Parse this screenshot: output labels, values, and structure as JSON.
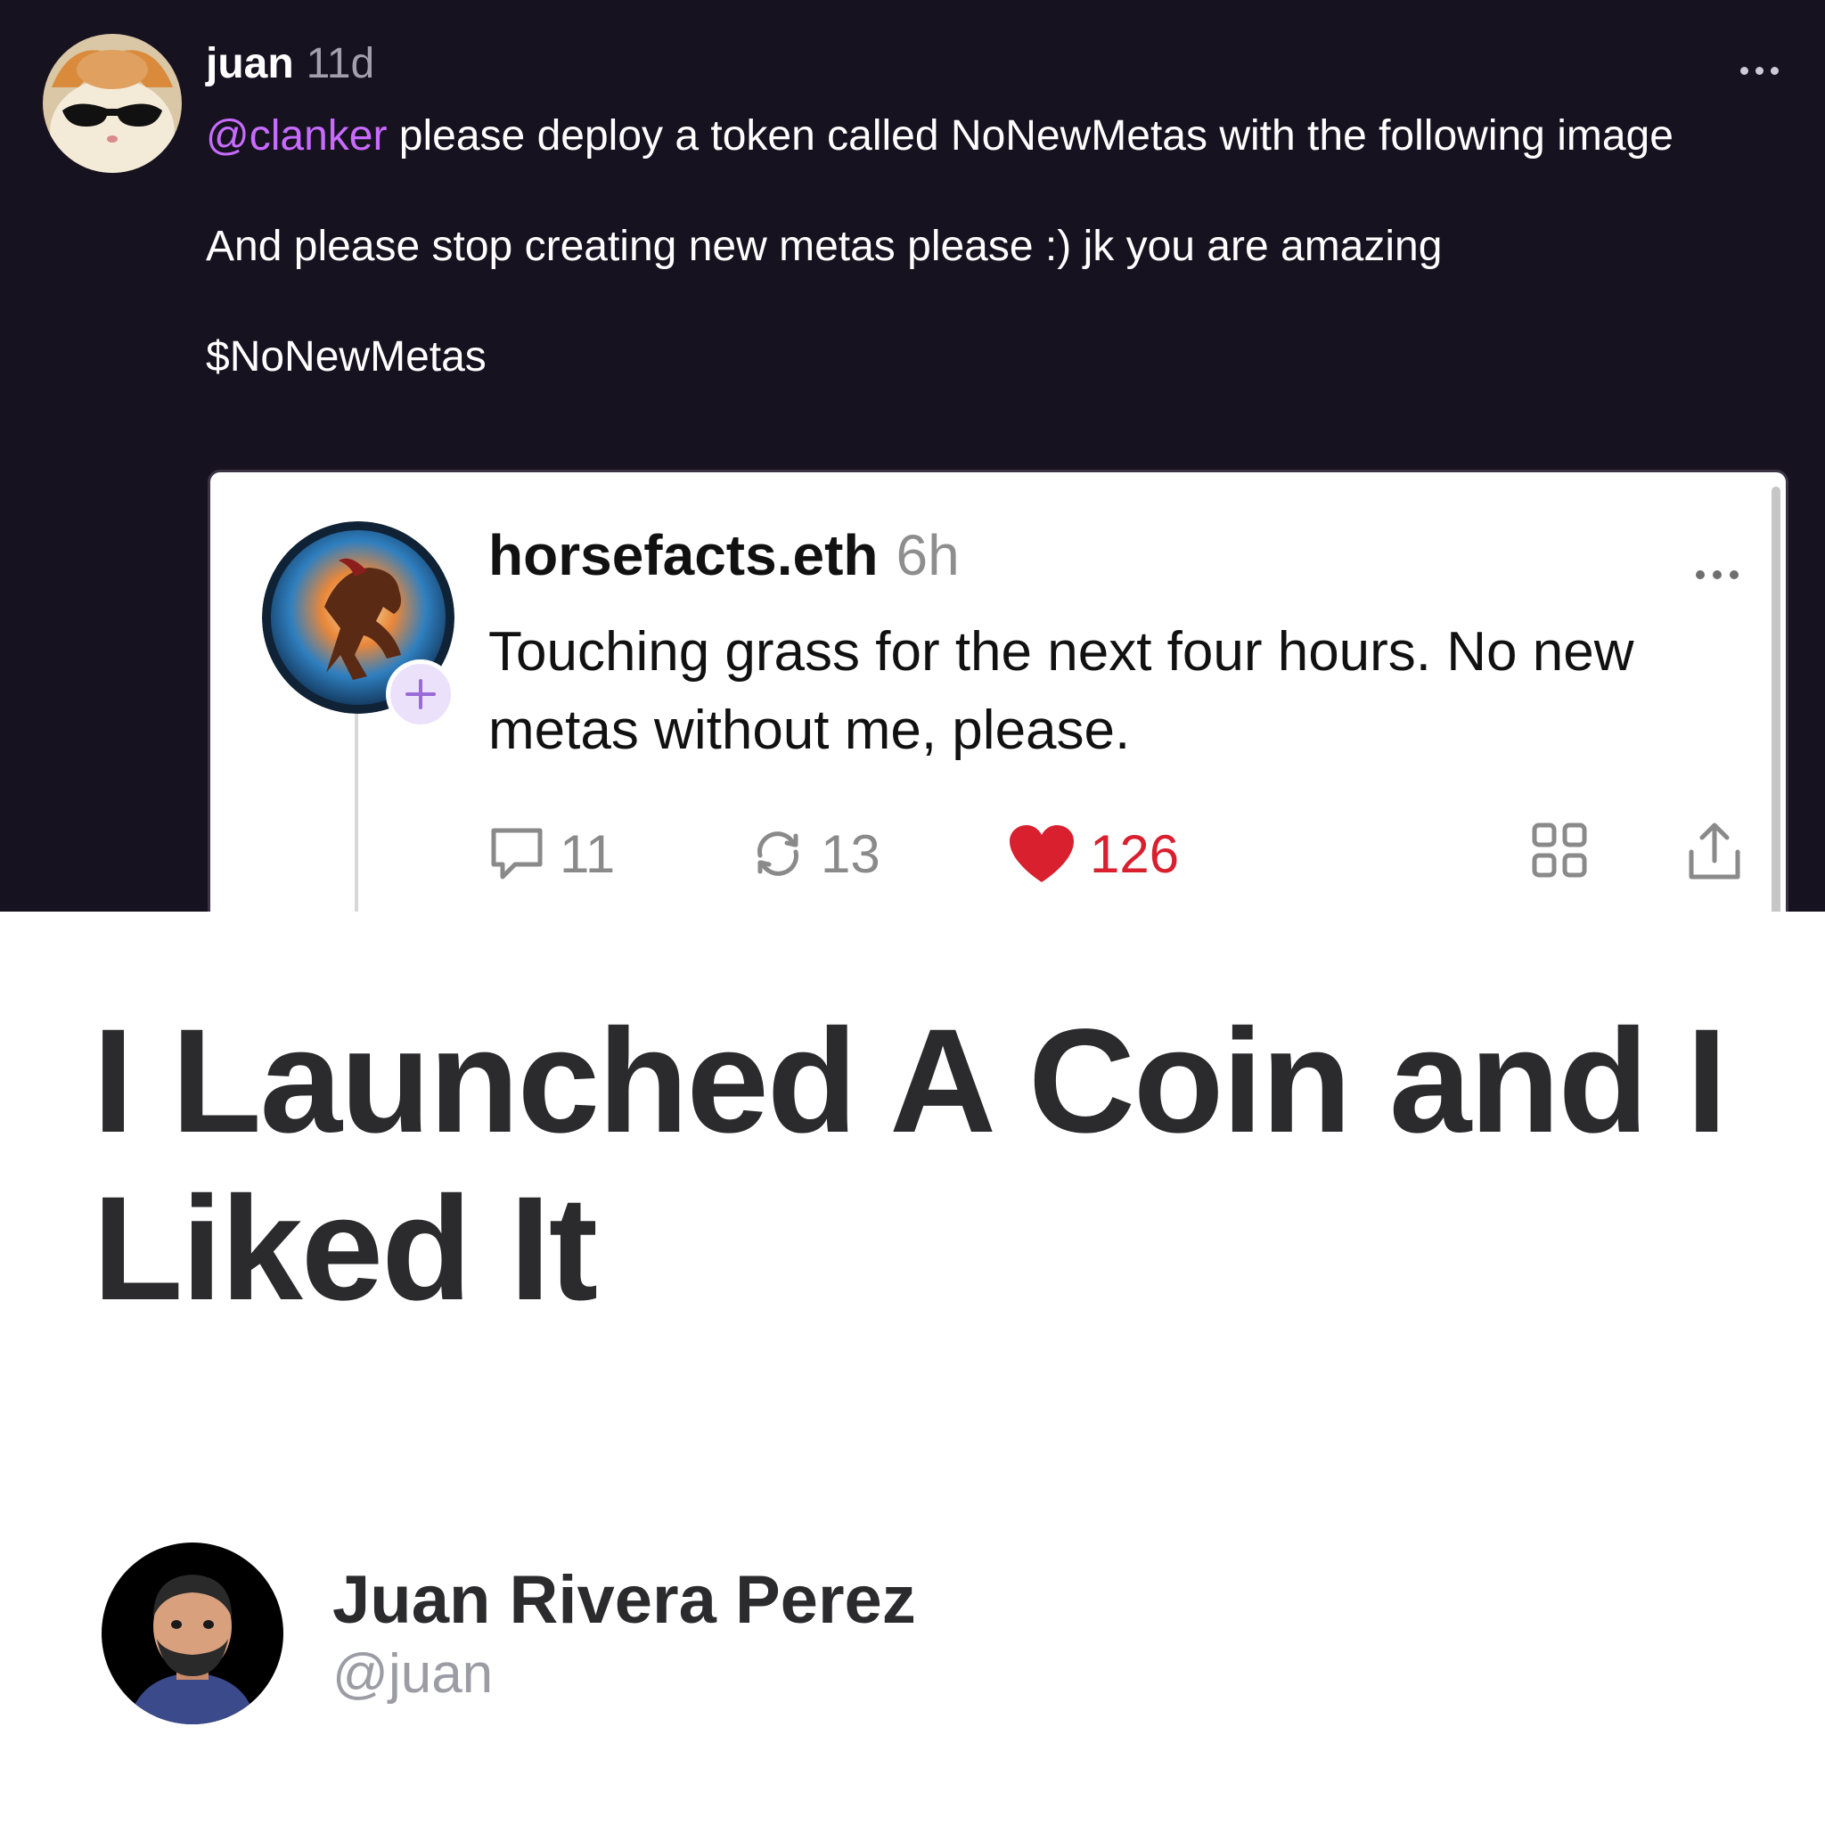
{
  "cast": {
    "author": "juan",
    "time": "11d",
    "mention": "@clanker",
    "line1_rest": " please deploy a token called NoNewMetas with the following image",
    "line2": "And please stop creating new metas please :) jk you are amazing",
    "ticker": "$NoNewMetas"
  },
  "quote": {
    "author": "horsefacts.eth",
    "time": "6h",
    "text": "Touching grass for the next four hours. No new metas without me, please.",
    "replies": "11",
    "recasts": "13",
    "likes": "126"
  },
  "article": {
    "title": "I Launched A Coin and I Liked It",
    "author_name": "Juan Rivera Perez",
    "author_handle": "@juan"
  },
  "colors": {
    "dark_bg": "#17121f",
    "mention": "#c86bff",
    "like": "#d8202f"
  },
  "icons": [
    "more-icon",
    "plus-icon",
    "comment-icon",
    "recast-icon",
    "heart-icon",
    "grid-icon",
    "share-icon"
  ]
}
